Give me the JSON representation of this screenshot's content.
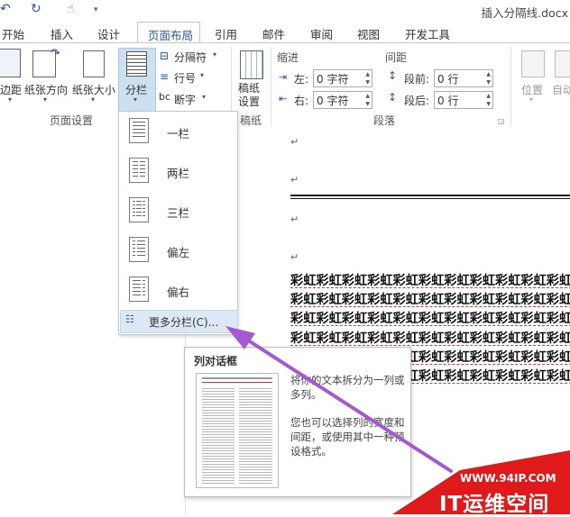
{
  "window": {
    "title": "插入分隔线.docx"
  },
  "tabs": [
    "开始",
    "插入",
    "设计",
    "页面布局",
    "引用",
    "邮件",
    "审阅",
    "视图",
    "开发工具"
  ],
  "ribbon": {
    "page_setup": {
      "margins": "边距",
      "orientation": "纸张方向",
      "size": "纸张大小",
      "columns": "分栏",
      "breaks": "分隔符",
      "line_numbers": "行号",
      "hyphenation": "断字",
      "group_label": "页面设置"
    },
    "draft": {
      "button": "稿纸\n设置",
      "group_label": "稿纸"
    },
    "paragraph": {
      "indent_header": "缩进",
      "spacing_header": "间距",
      "left_label": "左:",
      "left_value": "0 字符",
      "right_label": "右:",
      "right_value": "0 字符",
      "before_label": "段前:",
      "before_value": "0 行",
      "after_label": "段后:",
      "after_value": "0 行",
      "group_label": "段落"
    },
    "arrange": {
      "position": "位置",
      "wrap": "自动"
    }
  },
  "columns_menu": {
    "items": [
      "一栏",
      "两栏",
      "三栏",
      "偏左",
      "偏右"
    ],
    "more": "更多分栏(C)..."
  },
  "tooltip": {
    "title": "列对话框",
    "text1": "将你的文本拆分为一列或多列。",
    "text2": "您也可以选择列的宽度和间距，或使用其中一种预设格式。"
  },
  "document": {
    "mark": "↵",
    "rainbow": "彩虹彩虹彩虹彩虹彩虹彩虹彩虹彩虹彩虹彩虹彩虹彩虹彩虹彩虹彩虹彩虹彩虹彩虹彩虹彩虹"
  },
  "watermark": {
    "url": "WWW.94IP.COM",
    "brand": "IT运维空间"
  },
  "colors": {
    "accent": "#2b579a",
    "watermark_red": "#e0191b",
    "arrow": "#a459d1"
  }
}
